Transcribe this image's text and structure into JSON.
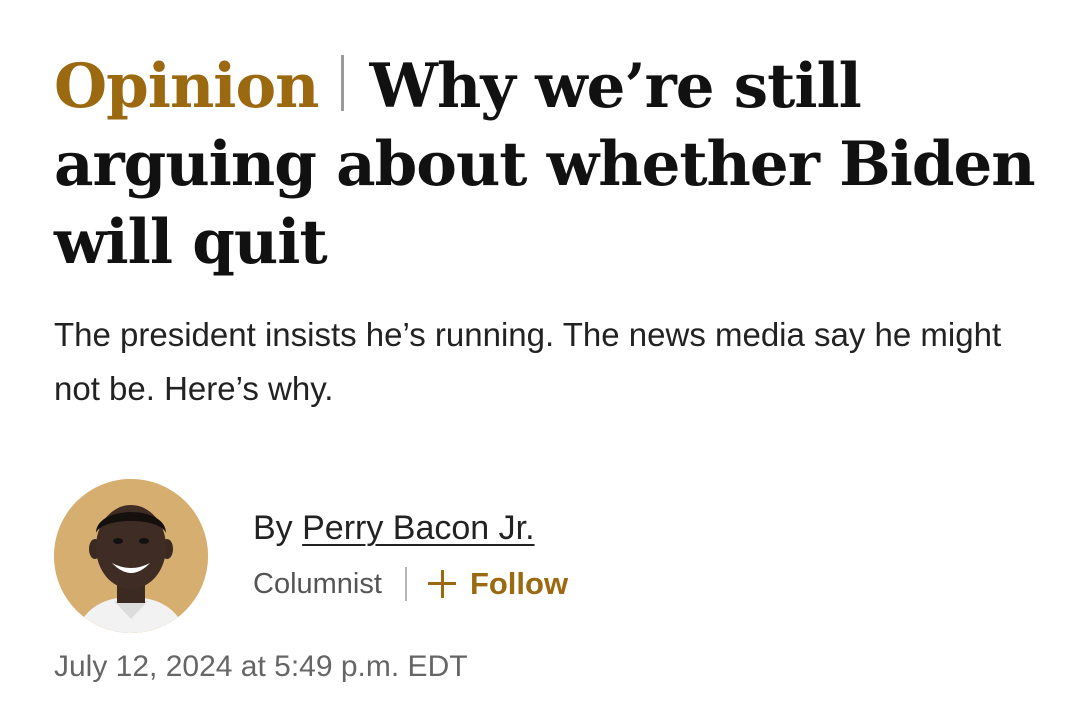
{
  "headline": {
    "kicker": "Opinion",
    "title": "Why we’re still arguing about whether Biden will quit"
  },
  "dek": "The president insists he’s running. The news media say he might not be. Here’s why.",
  "byline": {
    "by_prefix": "By ",
    "author": "Perry Bacon Jr.",
    "role": "Columnist",
    "follow_label": "Follow",
    "follow_icon": "plus-icon"
  },
  "timestamp": "July 12, 2024 at 5:49 p.m. EDT",
  "colors": {
    "accent": "#9b6a10",
    "avatar_bg": "#d6ae6f",
    "text": "#111111",
    "muted": "#666666"
  }
}
